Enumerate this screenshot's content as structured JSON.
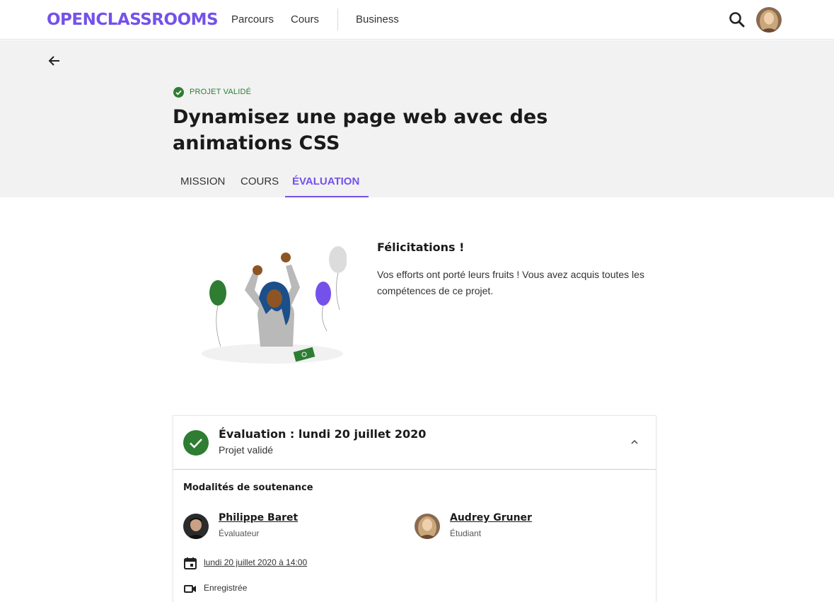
{
  "brand": {
    "logo_text": "OPENCLASSROOMS",
    "accent": "#7451eb"
  },
  "nav": {
    "links": [
      "Parcours",
      "Cours",
      "Business"
    ],
    "search_icon": "search-icon",
    "avatar": "user-avatar"
  },
  "hero": {
    "back_icon": "arrow-left-icon",
    "status": "PROJET VALIDÉ",
    "status_color": "#2e7d32",
    "title": "Dynamisez une page web avec des animations CSS",
    "tabs": [
      "MISSION",
      "COURS",
      "ÉVALUATION"
    ],
    "active_tab": "ÉVALUATION"
  },
  "congrats": {
    "title": "Félicitations !",
    "text": "Vos efforts ont porté leurs fruits ! Vous avez acquis toutes les compétences de ce projet."
  },
  "evaluation": {
    "title": "Évaluation : lundi 20 juillet 2020",
    "subtitle": "Projet validé",
    "modalities_title": "Modalités de soutenance",
    "people": [
      {
        "name": "Philippe Baret",
        "role": "Évaluateur"
      },
      {
        "name": "Audrey Gruner",
        "role": "Étudiant"
      }
    ],
    "date_link": "lundi 20 juillet 2020 à 14:00",
    "recording": "Enregistrée"
  }
}
